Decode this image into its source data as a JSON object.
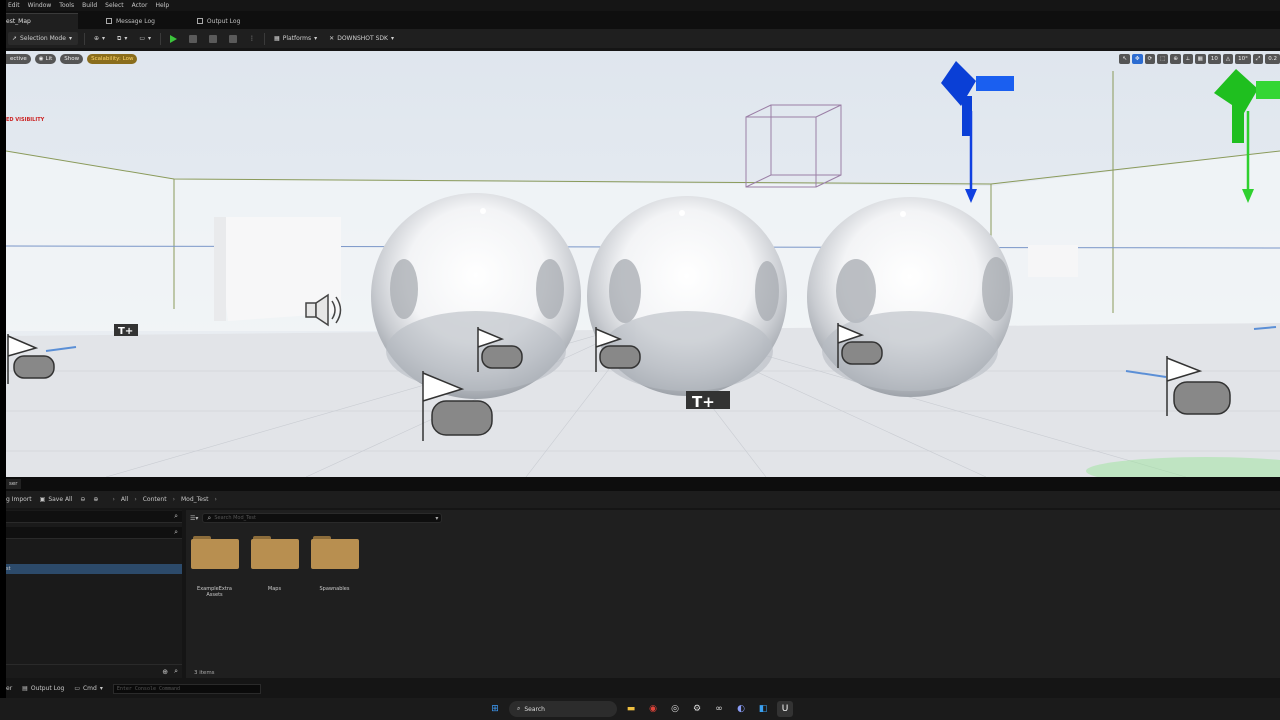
{
  "menu": [
    "Edit",
    "Window",
    "Tools",
    "Build",
    "Select",
    "Actor",
    "Help"
  ],
  "tabs": [
    {
      "label": "est_Map"
    },
    {
      "label": "Message Log"
    },
    {
      "label": "Output Log"
    }
  ],
  "toolbar": {
    "selection_mode": "Selection Mode",
    "platforms": "Platforms",
    "downshot": "DOWNSHOT SDK"
  },
  "viewport": {
    "perspective": "ective",
    "lit": "Lit",
    "show": "Show",
    "scalability": "Scalability: Low",
    "warning": "ED VISIBILITY",
    "grid_value": "10",
    "rotation_value": "10°",
    "scale_value": "0.2"
  },
  "content_browser": {
    "tab_label": "ser",
    "import_label": "g Import",
    "save_all": "Save All",
    "breadcrumb": [
      "All",
      "Content",
      "Mod_Test"
    ],
    "search_placeholder": "Search Mod_Test",
    "tree_item": "st",
    "folders": [
      {
        "name": "ExampleExtra Assets"
      },
      {
        "name": "Maps"
      },
      {
        "name": "Spawnables"
      }
    ],
    "items_count": "3 items"
  },
  "status": {
    "drawer": "er",
    "output_log": "Output Log",
    "cmd": "Cmd",
    "console_placeholder": "Enter Console Command"
  },
  "taskbar": {
    "search": "Search"
  },
  "colors": {
    "blue_gizmo": "#0a3fd6",
    "green_gizmo": "#1fbf1f",
    "play_green": "#3cc43c",
    "folder": "#b88f50"
  }
}
